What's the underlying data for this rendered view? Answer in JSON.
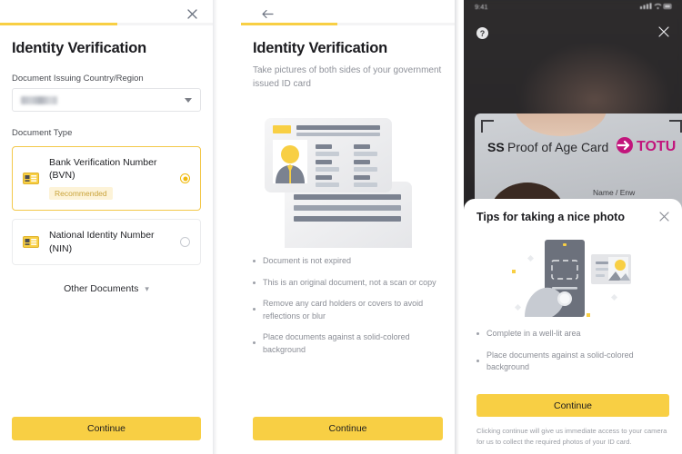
{
  "panel1": {
    "close_icon": "close-icon",
    "progress_percent": 55,
    "title": "Identity Verification",
    "country_label": "Document Issuing Country/Region",
    "country_value": "",
    "doc_type_label": "Document Type",
    "doc_types": [
      {
        "name": "Bank Verification Number (BVN)",
        "badge": "Recommended",
        "selected": true,
        "icon": "id-card-icon"
      },
      {
        "name": "National Identity Number (NIN)",
        "badge": "",
        "selected": false,
        "icon": "id-card-icon"
      }
    ],
    "other_documents_label": "Other Documents",
    "other_documents_chevron": "chevron-down-icon",
    "continue_label": "Continue"
  },
  "panel2": {
    "back_icon": "arrow-left-icon",
    "progress_percent": 45,
    "title": "Identity Verification",
    "subtitle": "Take pictures of both sides of your government issued ID card",
    "illustration": "id-cards-illustration",
    "bullets": [
      "Document is not expired",
      "This is an original document, not a scan or copy",
      "Remove any card holders or covers to avoid reflections or blur",
      "Place documents against a solid-colored background"
    ],
    "continue_label": "Continue"
  },
  "panel3": {
    "status_time": "9:41",
    "help_icon": "question-mark-icon",
    "close_icon": "close-icon",
    "card_preview": {
      "label_prefix": "SS",
      "label": "Proof of Age Card",
      "brand": "TOTU",
      "field_label": "Name / Enw",
      "extra_letter": "E"
    },
    "tips_title": "Tips for taking a nice photo",
    "tips_close_icon": "close-icon",
    "illustration": "phone-camera-illustration",
    "tips": [
      "Complete in a well-lit area",
      "Place documents against a solid-colored background"
    ],
    "continue_label": "Continue",
    "disclaimer": "Clicking continue will give us immediate access to your camera for us to collect the required photos of your ID card."
  },
  "colors": {
    "accent": "#F8CF44",
    "badge_bg": "#FDF3D8",
    "badge_text": "#C9A33A",
    "text_primary": "#1b1b1f",
    "text_muted": "#8b8e96"
  }
}
